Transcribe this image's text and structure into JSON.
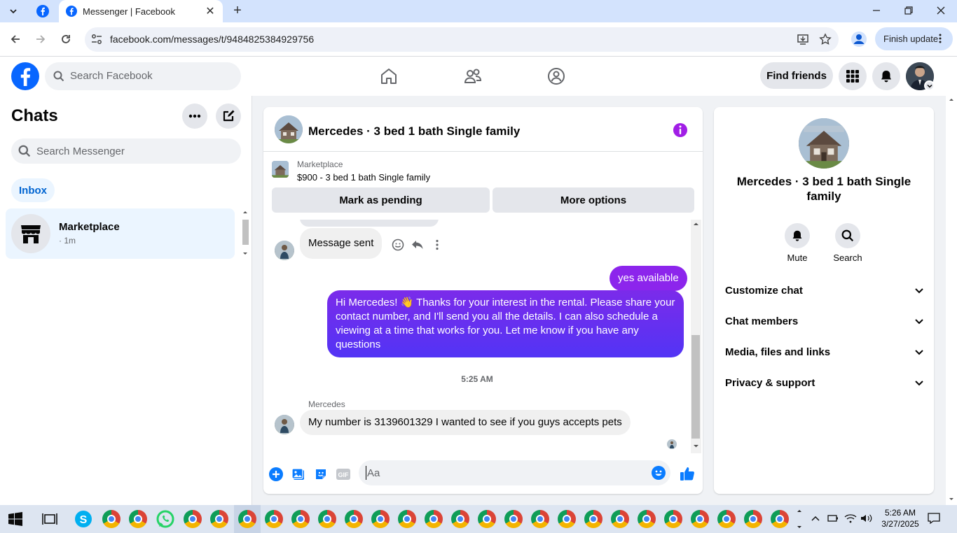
{
  "browser": {
    "tab_title": "Messenger | Facebook",
    "url": "facebook.com/messages/t/9484825384929756",
    "finish_update": "Finish update"
  },
  "fb": {
    "search_placeholder": "Search Facebook",
    "find_friends": "Find friends"
  },
  "left": {
    "title": "Chats",
    "search_placeholder": "Search Messenger",
    "inbox_label": "Inbox",
    "chats": [
      {
        "name": "Marketplace",
        "time": "· 1m"
      }
    ]
  },
  "conversation": {
    "title": "Mercedes · 3 bed 1 bath Single family",
    "marketplace_label": "Marketplace",
    "listing": "$900 - 3 bed 1 bath Single family",
    "mark_pending": "Mark as pending",
    "more_options": "More options",
    "messages": [
      {
        "from": "them",
        "text": "Message sent"
      },
      {
        "from": "me",
        "text": "yes available"
      },
      {
        "from": "me",
        "text": "Hi Mercedes! 👋 Thanks for your interest in the rental. Please share your contact number, and I'll send you all the details. I can also schedule a viewing at a time that works for you. Let me know if you have any questions"
      },
      {
        "from": "them",
        "sender": "Mercedes",
        "text": "My number is 3139601329 I wanted to see if you guys accepts pets"
      }
    ],
    "timestamp": "5:25 AM",
    "composer_placeholder": "Aa"
  },
  "right": {
    "name": "Mercedes · 3 bed 1 bath Single family",
    "mute": "Mute",
    "search": "Search",
    "sections": [
      "Customize chat",
      "Chat members",
      "Media, files and links",
      "Privacy & support"
    ]
  },
  "taskbar": {
    "time": "5:26 AM",
    "date": "3/27/2025"
  },
  "colors": {
    "fb_blue": "#0866ff",
    "messenger_purple": "#7a2ff0",
    "accent_blue": "#0064d1"
  }
}
